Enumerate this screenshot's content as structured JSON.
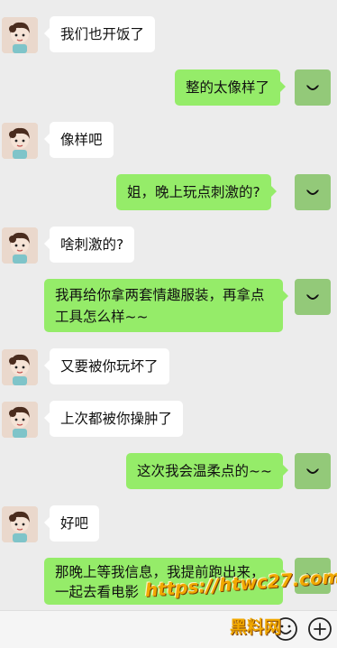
{
  "conversation": {
    "messages": [
      {
        "side": "left",
        "text": "我们也开饭了"
      },
      {
        "side": "right",
        "text": "整的太像样了"
      },
      {
        "side": "left",
        "text": "像样吧"
      },
      {
        "side": "right",
        "text": "姐，晚上玩点刺激的?"
      },
      {
        "side": "left",
        "text": "啥刺激的?"
      },
      {
        "side": "right",
        "text": "我再给你拿两套情趣服装，再拿点工具怎么样~~"
      },
      {
        "side": "left",
        "text": "又要被你玩坏了"
      },
      {
        "side": "left",
        "text": "上次都被你操肿了"
      },
      {
        "side": "right",
        "text": "这次我会温柔点的~~"
      },
      {
        "side": "left",
        "text": "好吧"
      },
      {
        "side": "right",
        "text": "那晚上等我信息，我提前跑出来，一起去看电影"
      }
    ]
  },
  "input_bar": {
    "emoji_icon": "emoji-face-icon",
    "plus_icon": "plus-circle-icon"
  },
  "watermark": {
    "line1": "https://htwc27.com",
    "line2": "黑料网"
  },
  "colors": {
    "background": "#ececec",
    "self_bubble": "#95ec69",
    "other_bubble": "#ffffff",
    "watermark": "#f2a900"
  }
}
